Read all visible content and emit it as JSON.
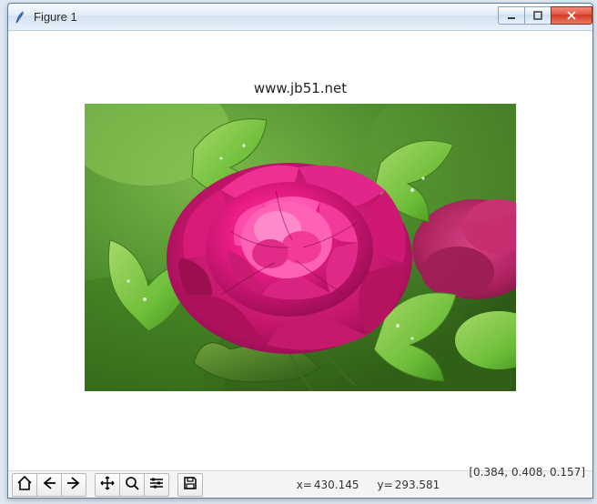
{
  "window": {
    "title": "Figure 1"
  },
  "plot": {
    "title": "www.jb51.net"
  },
  "status": {
    "x_label": "x=",
    "x_value": "430.145",
    "y_label": "y=",
    "y_value": "293.581",
    "rgb": "[0.384, 0.408, 0.157]"
  }
}
